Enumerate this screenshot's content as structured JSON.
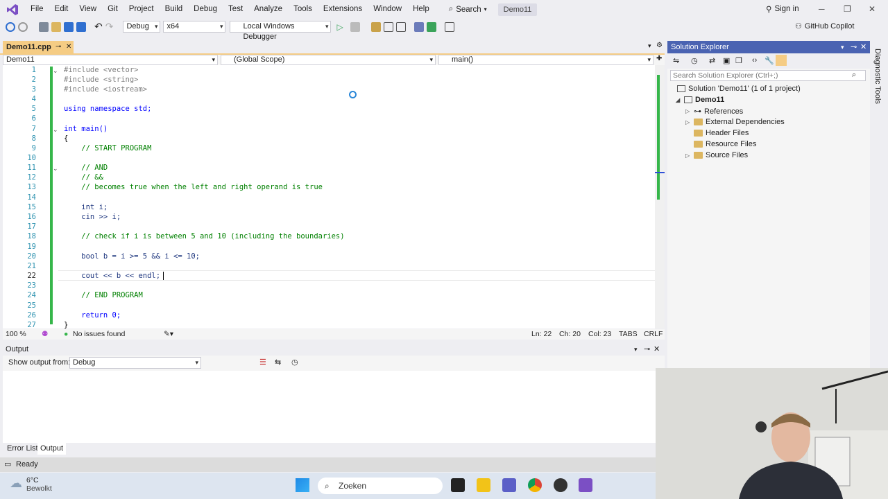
{
  "menu": [
    "File",
    "Edit",
    "View",
    "Git",
    "Project",
    "Build",
    "Debug",
    "Test",
    "Analyze",
    "Tools",
    "Extensions",
    "Window",
    "Help"
  ],
  "search_label": "Search",
  "solution_title": "Demo11",
  "sign_in": "Sign in",
  "toolbar": {
    "config": "Debug",
    "platform": "x64",
    "debugger": "Local Windows Debugger",
    "copilot": "GitHub Copilot"
  },
  "doc_tab": {
    "label": "Demo11.cpp"
  },
  "nav": {
    "project": "Demo11",
    "scope": "(Global Scope)",
    "member": "main()"
  },
  "code_lines": [
    {
      "n": "1"
    },
    {
      "n": "2"
    },
    {
      "n": "3"
    },
    {
      "n": "4"
    },
    {
      "n": "5"
    },
    {
      "n": "6"
    },
    {
      "n": "7"
    },
    {
      "n": "8"
    },
    {
      "n": "9"
    },
    {
      "n": "10"
    },
    {
      "n": "11"
    },
    {
      "n": "12"
    },
    {
      "n": "13"
    },
    {
      "n": "14"
    },
    {
      "n": "15"
    },
    {
      "n": "16"
    },
    {
      "n": "17"
    },
    {
      "n": "18"
    },
    {
      "n": "19"
    },
    {
      "n": "20"
    },
    {
      "n": "21"
    },
    {
      "n": "22"
    },
    {
      "n": "23"
    },
    {
      "n": "24"
    },
    {
      "n": "25"
    },
    {
      "n": "26"
    },
    {
      "n": "27"
    }
  ],
  "code": {
    "inc1": "#include <vector>",
    "inc2": "#include <string>",
    "inc3": "#include <iostream>",
    "l5": "using namespace std;",
    "l7": "int main()",
    "l8": "{",
    "l9": "    // START PROGRAM",
    "l11": "    // AND",
    "l12": "    // &&",
    "l13": "    // becomes true when the left and right operand is true",
    "l15": "    int i;",
    "l16": "    cin >> i;",
    "l18": "    // check if i is between 5 and 10 (including the boundaries)",
    "l20": "    bool b = i >= 5 && i <= 10;",
    "l22": "    cout << b << endl;",
    "l24": "    // END PROGRAM",
    "l26": "    return 0;",
    "l27": "}"
  },
  "editor_status": {
    "zoom": "100 %",
    "issues": "No issues found",
    "ln": "Ln: 22",
    "ch": "Ch: 20",
    "col": "Col: 23",
    "tabs": "TABS",
    "crlf": "CRLF"
  },
  "output": {
    "title": "Output",
    "show_from_label": "Show output from:",
    "source": "Debug"
  },
  "bottom_tabs": [
    "Error List",
    "Output"
  ],
  "status": "Ready",
  "solution_explorer": {
    "title": "Solution Explorer",
    "search_placeholder": "Search Solution Explorer (Ctrl+;)",
    "solution": "Solution 'Demo11' (1 of 1 project)",
    "project": "Demo11",
    "items": [
      "References",
      "External Dependencies",
      "Header Files",
      "Resource Files",
      "Source Files"
    ]
  },
  "diagnostic_tools": "Diagnostic Tools",
  "taskbar": {
    "temp": "6°C",
    "weather": "Bewolkt",
    "search": "Zoeken"
  }
}
